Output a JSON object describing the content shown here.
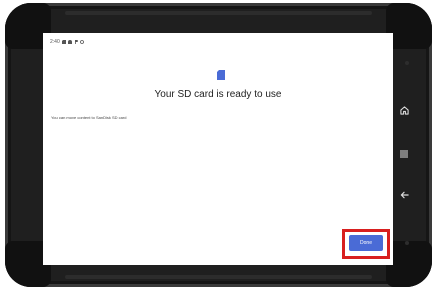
{
  "status_bar": {
    "time": "2:40",
    "icons": [
      "sd-card-icon",
      "android-icon",
      "p-icon",
      "sync-icon"
    ]
  },
  "dialog": {
    "icon": "sd-card-icon",
    "title": "Your SD card is ready to use",
    "body": "You can move content to SanDisk SD card",
    "done_label": "Done"
  },
  "nav_buttons": [
    "home-icon",
    "menu-icon",
    "back-icon"
  ],
  "colors": {
    "accent": "#4a6bd6",
    "highlight": "#d81f1f",
    "device_body": "#1f1f1f"
  }
}
